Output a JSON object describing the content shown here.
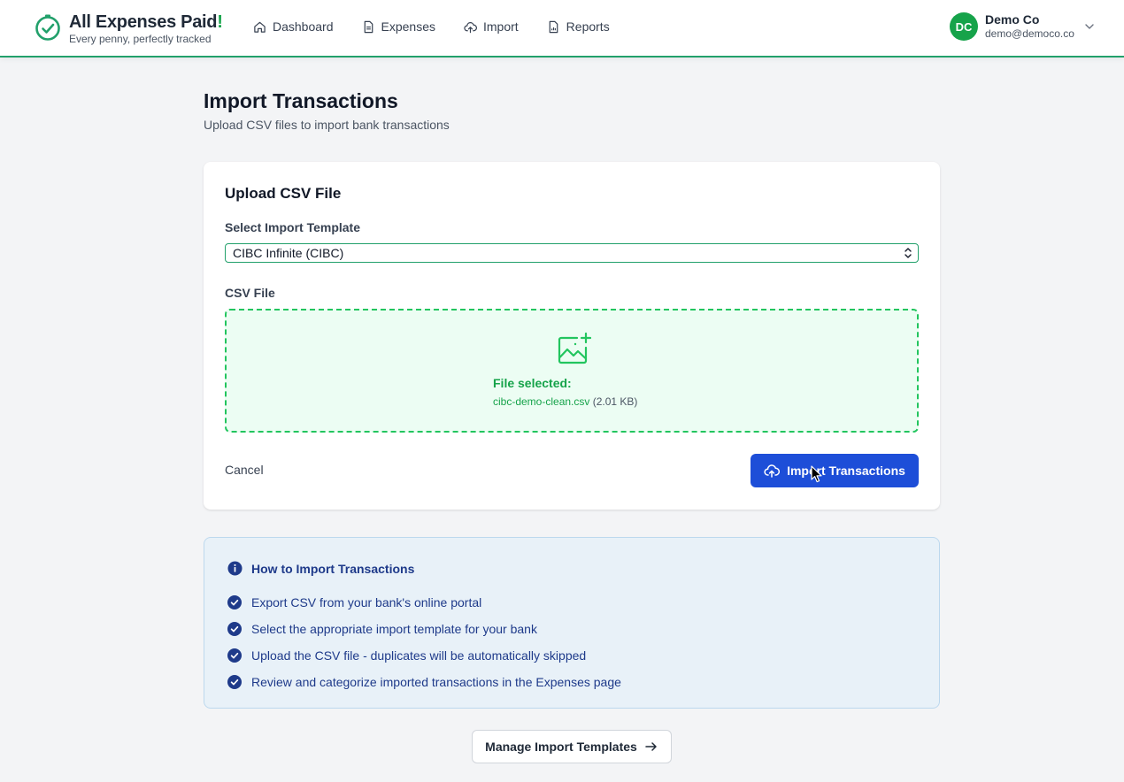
{
  "header": {
    "brand_title": "All Expenses Paid",
    "brand_bang": "!",
    "brand_tagline": "Every penny, perfectly tracked",
    "nav": [
      {
        "label": "Dashboard",
        "icon": "home-icon"
      },
      {
        "label": "Expenses",
        "icon": "document-icon"
      },
      {
        "label": "Import",
        "icon": "cloud-upload-icon"
      },
      {
        "label": "Reports",
        "icon": "report-icon"
      }
    ],
    "user": {
      "initials": "DC",
      "name": "Demo Co",
      "email": "demo@democo.co"
    }
  },
  "page": {
    "title": "Import Transactions",
    "subtitle": "Upload CSV files to import bank transactions"
  },
  "upload_card": {
    "title": "Upload CSV File",
    "template_label": "Select Import Template",
    "template_value": "CIBC Infinite (CIBC)",
    "file_label": "CSV File",
    "file_selected_label": "File selected:",
    "file_name": "cibc-demo-clean.csv",
    "file_size": "(2.01 KB)",
    "cancel_label": "Cancel",
    "import_label": "Import Transactions"
  },
  "info": {
    "title": "How to Import Transactions",
    "steps": [
      "Export CSV from your bank's online portal",
      "Select the appropriate import template for your bank",
      "Upload the CSV file - duplicates will be automatically skipped",
      "Review and categorize imported transactions in the Expenses page"
    ]
  },
  "manage_label": "Manage Import Templates",
  "colors": {
    "brand_green": "#16a34a",
    "primary_blue": "#1d4ed8",
    "info_blue": "#1e3a8a"
  }
}
